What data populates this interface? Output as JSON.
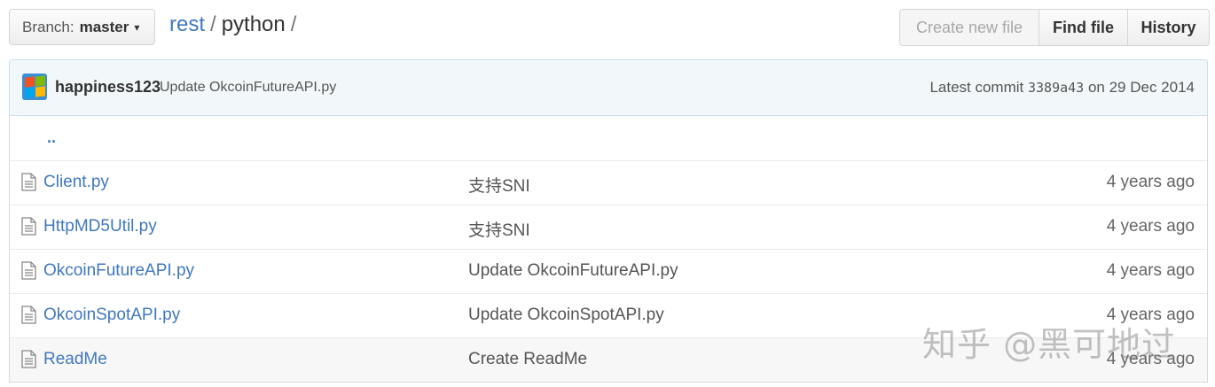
{
  "branch": {
    "label": "Branch:",
    "value": "master"
  },
  "breadcrumb": {
    "repo": "rest",
    "sep1": "/",
    "dir": "python",
    "sep2": "/"
  },
  "actions": {
    "create_new_file": "Create new file",
    "find_file": "Find file",
    "history": "History"
  },
  "commit": {
    "author": "happiness123",
    "message": "Update OkcoinFutureAPI.py",
    "latest_label": "Latest commit",
    "sha": "3389a43",
    "on_label": "on",
    "date": "29 Dec 2014"
  },
  "parent_dir": "..",
  "files": [
    {
      "name": "Client.py",
      "message": "支持SNI",
      "age": "4 years ago"
    },
    {
      "name": "HttpMD5Util.py",
      "message": "支持SNI",
      "age": "4 years ago"
    },
    {
      "name": "OkcoinFutureAPI.py",
      "message": "Update OkcoinFutureAPI.py",
      "age": "4 years ago"
    },
    {
      "name": "OkcoinSpotAPI.py",
      "message": "Update OkcoinSpotAPI.py",
      "age": "4 years ago"
    },
    {
      "name": "ReadMe",
      "message": "Create ReadMe",
      "age": "4 years ago"
    }
  ],
  "watermark": "知乎 @黑可地过",
  "icons": {
    "file": "file-text-icon",
    "caret": "caret-down-icon",
    "avatar": "windows-logo-avatar"
  },
  "colors": {
    "link": "#4078c0",
    "commit_bg": "#f2f8fa",
    "commit_border": "#c9e0ea"
  }
}
